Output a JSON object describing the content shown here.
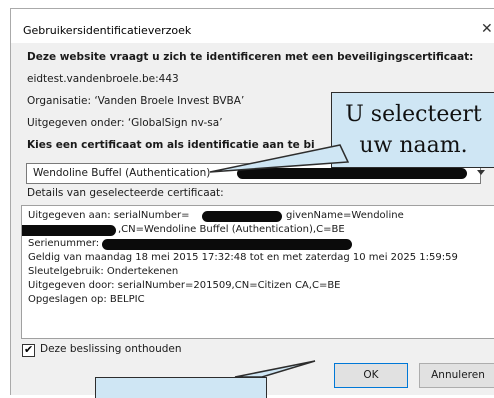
{
  "window": {
    "title": "Gebruikersidentificatieverzoek",
    "close_glyph": "✕"
  },
  "content": {
    "heading": "Deze website vraagt u zich te identificeren met een beveiligingscertificaat:",
    "host": "eidtest.vandenbroele.be:443",
    "organization": "Organisatie: ‘Vanden Broele Invest BVBA’",
    "issued_under": "Uitgegeven onder: ‘GlobalSign nv-sa’",
    "choose_label": "Kies een certificaat om als identificatie aan te bi"
  },
  "certificate_select": {
    "value": "Wendoline Buffel (Authentication)"
  },
  "details": {
    "label": "Details van geselecteerde certificaat:",
    "issued_to_prefix": "Uitgegeven aan: serialNumber=",
    "issued_to_suffix": "givenName=Wendoline",
    "cn_line": ",CN=Wendoline Buffel (Authentication),C=BE",
    "serial_label": "Serienummer:",
    "validity": "Geldig van maandag 18 mei 2015 17:32:48 tot en met zaterdag 10 mei 2025 1:59:59",
    "key_usage": "Sleutelgebruik: Ondertekenen",
    "issued_by": "Uitgegeven door: serialNumber=201509,CN=Citizen CA,C=BE",
    "stored_in": "Opgeslagen op: BELPIC"
  },
  "remember": {
    "label": "Deze beslissing onthouden",
    "checked": true,
    "mark": "✔"
  },
  "buttons": {
    "ok": "OK",
    "cancel": "Annuleren"
  },
  "callout": {
    "line1": "U selecteert",
    "line2": "uw naam."
  },
  "colors": {
    "callout_fill": "#cfe6f4",
    "dialog_bg": "#f0f0f0",
    "ok_border": "#0078d7"
  }
}
